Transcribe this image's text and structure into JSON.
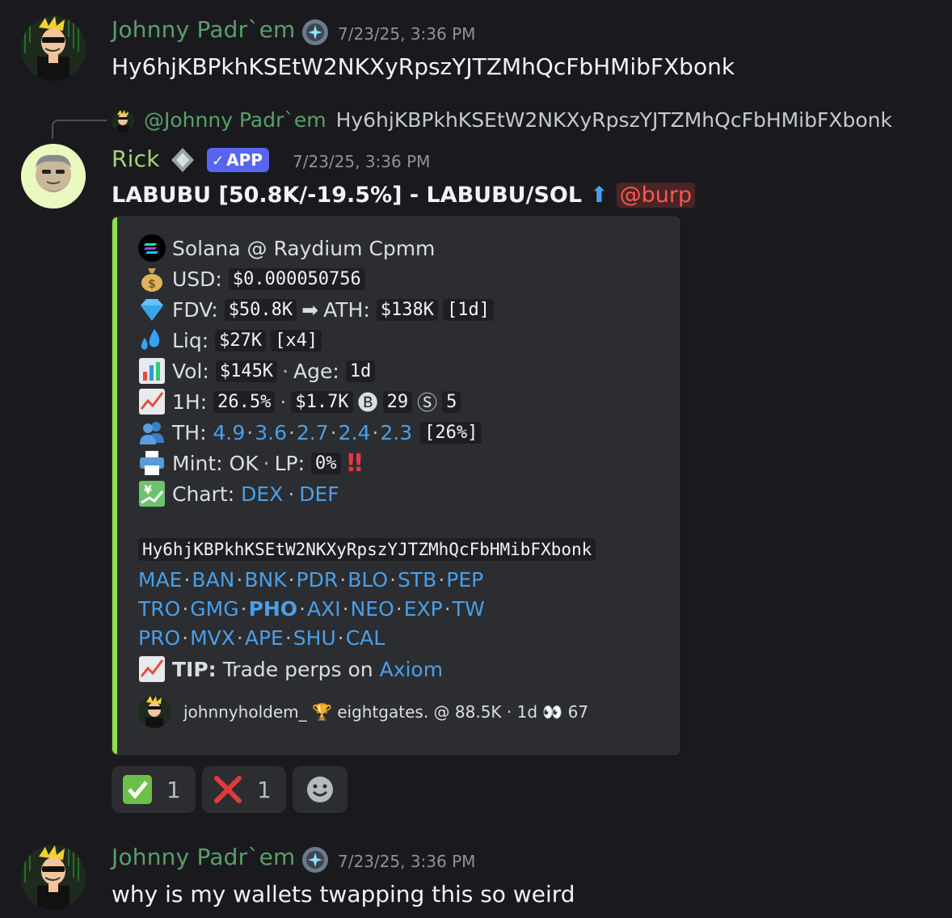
{
  "messages": [
    {
      "author": "Johnny Padr`em",
      "timestamp": "7/23/25, 3:36 PM",
      "text": "Hy6hjKBPkhKSEtW2NKXyRpszYJTZMhQcFbHMibFXbonk"
    },
    {
      "author": "Rick",
      "badge": "APP",
      "timestamp": "7/23/25, 3:36 PM",
      "reply": {
        "author": "@Johnny Padr`em",
        "text": "Hy6hjKBPkhKSEtW2NKXyRpszYJTZMhQcFbHMibFXbonk"
      },
      "title": "LABUBU [50.8K/-19.5%] - LABUBU/SOL",
      "arrow": "⬆",
      "mention": "@burp"
    },
    {
      "author": "Johnny Padr`em",
      "timestamp": "7/23/25, 3:36 PM",
      "text": "why is my wallets twapping this so weird"
    }
  ],
  "embed": {
    "venue": "Solana @ Raydium Cpmm",
    "usd_label": "USD:",
    "usd": "$0.000050756",
    "fdv_label": "FDV:",
    "fdv": "$50.8K",
    "ath_label": "ATH:",
    "ath": "$138K",
    "ath_age": "[1d]",
    "liq_label": "Liq:",
    "liq": "$27K",
    "liq_mult": "[x4]",
    "vol_label": "Vol:",
    "vol": "$145K",
    "age_label": "Age:",
    "age": "1d",
    "h1_label": "1H:",
    "h1_pct": "26.5%",
    "h1_vol": "$1.7K",
    "buys": "29",
    "sells": "5",
    "th_label": "TH:",
    "th": [
      "4.9",
      "3.6",
      "2.7",
      "2.4",
      "2.3"
    ],
    "th_pct": "[26%]",
    "mint_label": "Mint: OK",
    "lp_label": "LP:",
    "lp": "0%",
    "chart_label": "Chart:",
    "chart_links": [
      "DEX",
      "DEF"
    ],
    "address": "Hy6hjKBPkhKSEtW2NKXyRpszYJTZMhQcFbHMibFXbonk",
    "tags_row1": [
      "MAE",
      "BAN",
      "BNK",
      "PDR",
      "BLO",
      "STB",
      "PEP"
    ],
    "tags_row2": [
      "TRO",
      "GMG",
      "PHO",
      "AXI",
      "NEO",
      "EXP",
      "TW"
    ],
    "tags_row3": [
      "PRO",
      "MVX",
      "APE",
      "SHU",
      "CAL"
    ],
    "tip_label": "TIP:",
    "tip_text": "Trade perps on",
    "tip_link": "Axiom",
    "footer": "johnnyholdem_ 🏆 eightgates. @ 88.5K · 1d 👀 67"
  },
  "reactions": [
    {
      "emoji": "check-mark",
      "count": "1"
    },
    {
      "emoji": "cross-mark",
      "count": "1"
    },
    {
      "emoji": "add-reaction",
      "count": ""
    }
  ],
  "colors": {
    "background": "#1a1a1e",
    "embed_bar": "#8be04e",
    "link": "#4a9fe8",
    "app_badge": "#5865f2"
  }
}
